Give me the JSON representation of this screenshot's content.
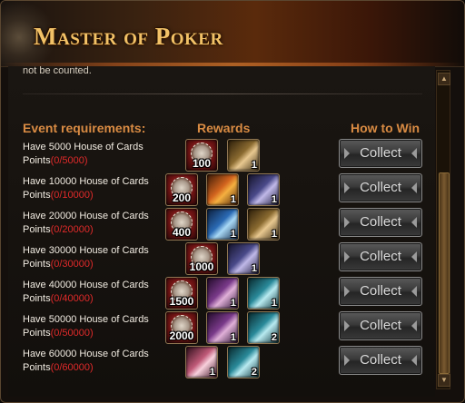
{
  "window": {
    "title": "Master of Poker"
  },
  "cut_text": "not be counted.",
  "headers": {
    "requirements": "Event requirements:",
    "rewards": "Rewards",
    "how_to_win": "How to Win"
  },
  "rows": [
    {
      "req_line1": "Have 5000 House of Cards",
      "req_line2": "Points",
      "progress": "(0/5000)",
      "rewards": [
        {
          "icon": "poker-chip-icon",
          "qty": "100"
        },
        {
          "icon": "hero-card-gold-icon",
          "qty": "1"
        }
      ],
      "button": "Collect"
    },
    {
      "req_line1": "Have 10000 House of Cards",
      "req_line2": "Points",
      "progress": "(0/10000)",
      "rewards": [
        {
          "icon": "poker-chip-icon",
          "qty": "200"
        },
        {
          "icon": "fire-card-icon",
          "qty": "1"
        },
        {
          "icon": "hero-card-violet-icon",
          "qty": "1"
        }
      ],
      "button": "Collect"
    },
    {
      "req_line1": "Have 20000 House of Cards",
      "req_line2": "Points",
      "progress": "(0/20000)",
      "rewards": [
        {
          "icon": "poker-chip-icon",
          "qty": "400"
        },
        {
          "icon": "ice-card-icon",
          "qty": "1"
        },
        {
          "icon": "hero-card-gold-icon",
          "qty": "1"
        }
      ],
      "button": "Collect"
    },
    {
      "req_line1": "Have 30000 House of Cards",
      "req_line2": "Points",
      "progress": "(0/30000)",
      "rewards": [
        {
          "icon": "poker-chip-icon",
          "qty": "1000"
        },
        {
          "icon": "hero-card-violet-icon",
          "qty": "1"
        }
      ],
      "button": "Collect"
    },
    {
      "req_line1": "Have 40000 House of Cards",
      "req_line2": "Points",
      "progress": "(0/40000)",
      "rewards": [
        {
          "icon": "poker-chip-icon",
          "qty": "1500"
        },
        {
          "icon": "hero-card-purple-icon",
          "qty": "1"
        },
        {
          "icon": "hero-card-teal-icon",
          "qty": "1"
        }
      ],
      "button": "Collect"
    },
    {
      "req_line1": "Have 50000 House of Cards",
      "req_line2": "Points",
      "progress": "(0/50000)",
      "rewards": [
        {
          "icon": "poker-chip-icon",
          "qty": "2000"
        },
        {
          "icon": "hero-card-purple-icon",
          "qty": "1"
        },
        {
          "icon": "hero-card-teal-icon",
          "qty": "2"
        }
      ],
      "button": "Collect"
    },
    {
      "req_line1": "Have 60000 House of Cards",
      "req_line2": "Points",
      "progress": "(0/60000)",
      "rewards": [
        {
          "icon": "hero-card-pink-icon",
          "qty": "1"
        },
        {
          "icon": "hero-card-teal-icon",
          "qty": "2"
        }
      ],
      "button": "Collect"
    }
  ],
  "colors": {
    "title": "#f2c267",
    "header": "#d98b43",
    "progress": "#e02a2a"
  }
}
